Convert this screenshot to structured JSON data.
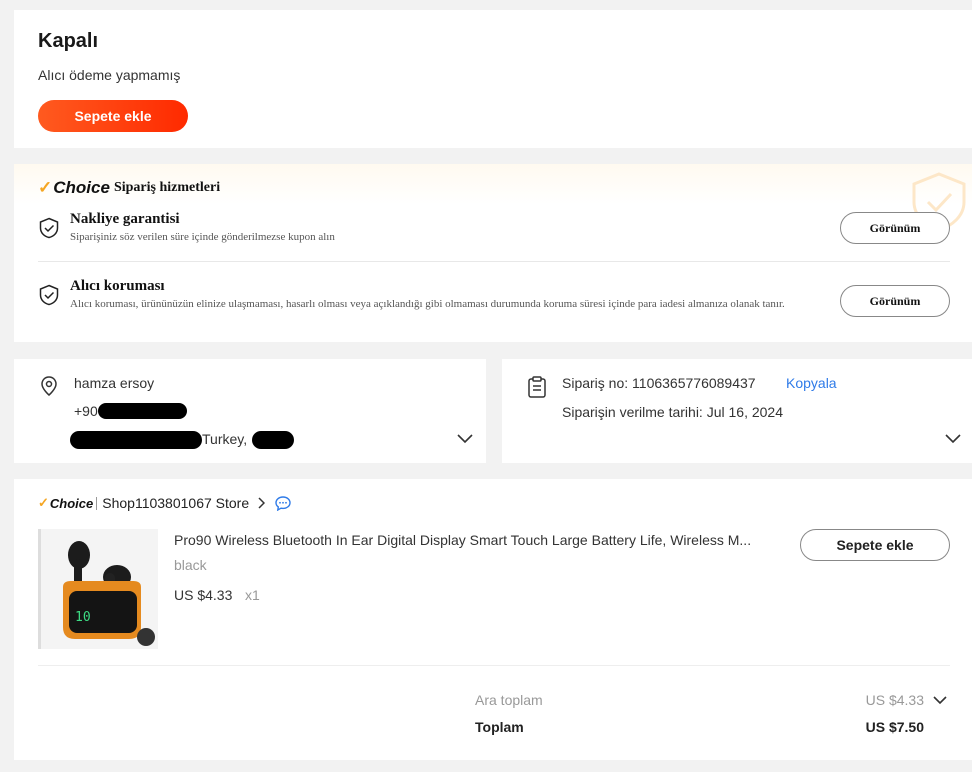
{
  "status": {
    "title": "Kapalı",
    "subtitle": "Alıcı ödeme yapmamış",
    "add_to_cart": "Sepete ekle"
  },
  "services": {
    "brand": "Choice",
    "title": "Sipariş hizmetleri",
    "items": [
      {
        "name": "Nakliye garantisi",
        "description": "Siparişiniz söz verilen süre içinde gönderilmezse kupon alın",
        "button": "Görünüm",
        "icon": "shield-check-icon"
      },
      {
        "name": "Alıcı koruması",
        "description": "Alıcı koruması, ürününüzün elinize ulaşmaması, hasarlı olması veya açıklandığı gibi olmaması durumunda koruma süresi içinde para iadesi almanıza olanak tanır.",
        "button": "Görünüm",
        "icon": "shield-check-icon"
      }
    ]
  },
  "address": {
    "name": "hamza ersoy",
    "phone_prefix": "+90",
    "country": "Turkey,",
    "icon": "location-pin-icon"
  },
  "order": {
    "number_label": "Sipariş no: 1106365776089437",
    "copy_label": "Kopyala",
    "date_label": "Siparişin verilme tarihi: Jul 16, 2024",
    "icon": "clipboard-icon"
  },
  "store": {
    "brand": "Choice",
    "name": "Shop1103801067 Store",
    "product": {
      "title": "Pro90 Wireless Bluetooth In Ear Digital Display Smart Touch Large Battery Life, Wireless M...",
      "variant": "black",
      "price": "US $4.33",
      "qty": "x1",
      "add_to_cart": "Sepete ekle"
    },
    "summary": {
      "subtotal_label": "Ara toplam",
      "subtotal_value": "US $4.33",
      "total_label": "Toplam",
      "total_value": "US $7.50"
    }
  },
  "colors": {
    "accent": "#ff4b14",
    "link": "#2f7be8",
    "choice_check": "#f5a623"
  }
}
